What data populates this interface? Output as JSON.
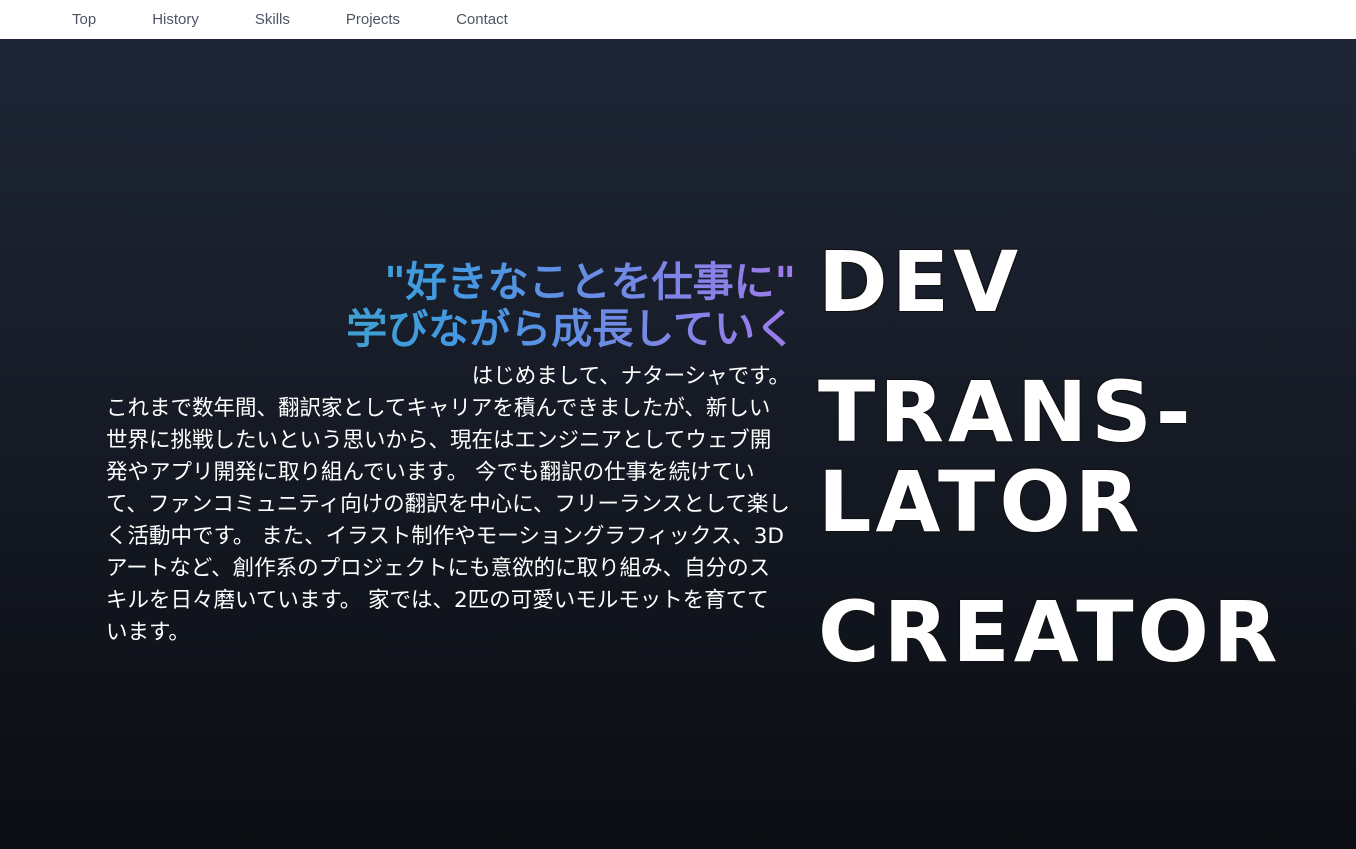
{
  "nav": {
    "items": [
      {
        "label": "Top"
      },
      {
        "label": "History"
      },
      {
        "label": "Skills"
      },
      {
        "label": "Projects"
      },
      {
        "label": "Contact"
      }
    ]
  },
  "hero": {
    "tagline": {
      "line1": "\"好きなことを仕事に\"",
      "line2": "学びながら成長していく"
    },
    "intro": {
      "first": "はじめまして、ナターシャです。",
      "body": "これまで数年間、翻訳家としてキャリアを積んできましたが、新しい世界に挑戦したいという思いから、現在はエンジニアとしてウェブ開発やアプリ開発に取り組んでいます。 今でも翻訳の仕事を続けていて、ファンコミュニティ向けの翻訳を中心に、フリーランスとして楽しく活動中です。 また、イラスト制作やモーショングラフィックス、3Dアートなど、創作系のプロジェクトにも意欲的に取り組み、自分のスキルを日々磨いています。 家では、2匹の可愛いモルモットを育てています。"
    },
    "roles": {
      "dev": "DEV",
      "translator_1": "TRANS-",
      "translator_2": "LATOR",
      "creator": "CREATOR"
    },
    "colors": {
      "gradient_start": "#38b2ac",
      "gradient_mid": "#4299e1",
      "gradient_end": "#9f7aea",
      "background_top": "#1e2636",
      "background_bottom": "#0b0d12"
    }
  }
}
